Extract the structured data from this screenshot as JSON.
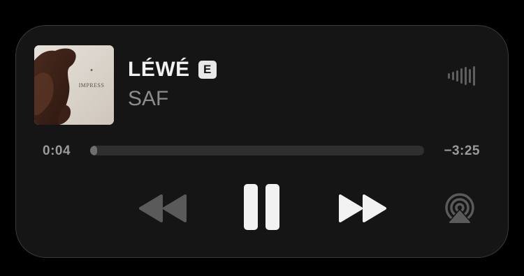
{
  "now_playing": {
    "title": "LÉWÉ",
    "explicit_badge": "E",
    "artist": "SAF",
    "artwork_text": "IMPRESS",
    "elapsed": "0:04",
    "remaining": "−3:25",
    "progress_fraction": 0.02
  },
  "icons": {
    "waveform": "audio-waveform-icon",
    "rewind": "rewind-icon",
    "pause": "pause-icon",
    "forward": "fast-forward-icon",
    "airplay": "airplay-icon"
  },
  "colors": {
    "background": "#000000",
    "panel": "#151515",
    "primary_text": "#f2f2f2",
    "secondary_text": "#8c8c8c",
    "disabled_control": "#5a5a5a"
  }
}
